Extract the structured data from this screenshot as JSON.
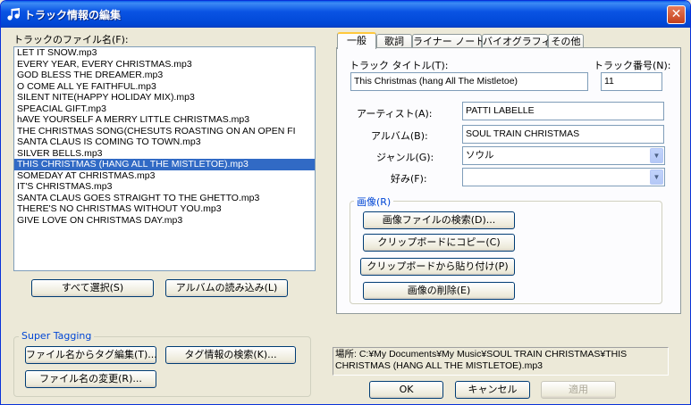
{
  "window": {
    "title": "トラック情報の編集",
    "close_label": "✕"
  },
  "left": {
    "files_label": "トラックのファイル名(F):",
    "files": [
      "LET IT SNOW.mp3",
      "EVERY YEAR, EVERY CHRISTMAS.mp3",
      "GOD BLESS THE DREAMER.mp3",
      "O COME ALL YE FAITHFUL.mp3",
      "SILENT NITE(HAPPY HOLIDAY MIX).mp3",
      "SPEACIAL GIFT.mp3",
      "hAVE YOURSELF A MERRY LITTLE CHRISTMAS.mp3",
      "THE CHRISTMAS SONG(CHESUTS ROASTING ON AN OPEN FI",
      "SANTA CLAUS IS COMING TO TOWN.mp3",
      "SILVER BELLS.mp3",
      "THIS CHRISTMAS (HANG ALL THE MISTLETOE).mp3",
      "SOMEDAY AT CHRISTMAS.mp3",
      "IT'S CHRISTMAS.mp3",
      "SANTA CLAUS GOES STRAIGHT TO THE GHETTO.mp3",
      "THERE'S NO CHRISTMAS WITHOUT YOU.mp3",
      "GIVE LOVE ON CHRISTMAS DAY.mp3"
    ],
    "selected_index": 10,
    "select_all_label": "すべて選択(S)",
    "load_album_label": "アルバムの読み込み(L)"
  },
  "super_tagging": {
    "title": "Super Tagging",
    "tag_from_filename_label": "ファイル名からタグ編集(T)...",
    "search_tag_label": "タグ情報の検索(K)...",
    "rename_file_label": "ファイル名の変更(R)..."
  },
  "tabs": [
    "一般",
    "歌詞",
    "ライナー ノート",
    "バイオグラフィ",
    "その他"
  ],
  "active_tab": 0,
  "general": {
    "track_title_label": "トラック タイトル(T):",
    "track_title_value": "This Christmas (hang All The Mistletoe)",
    "track_number_label": "トラック番号(N):",
    "track_number_value": "11",
    "artist_label": "アーティスト(A):",
    "artist_value": "PATTI LABELLE",
    "album_label": "アルバム(B):",
    "album_value": "SOUL TRAIN CHRISTMAS",
    "genre_label": "ジャンル(G):",
    "genre_value": "ソウル",
    "rating_label": "好み(F):",
    "rating_value": "",
    "image_group_label": "画像(R)",
    "search_image_label": "画像ファイルの検索(D)...",
    "copy_clipboard_label": "クリップボードにコピー(C)",
    "paste_clipboard_label": "クリップボードから貼り付け(P)",
    "delete_image_label": "画像の削除(E)"
  },
  "location_text": "場所: C:¥My Documents¥My Music¥SOUL TRAIN CHRISTMAS¥THIS CHRISTMAS (HANG ALL THE MISTLETOE).mp3",
  "dialog_buttons": {
    "ok": "OK",
    "cancel": "キャンセル",
    "apply": "適用"
  }
}
